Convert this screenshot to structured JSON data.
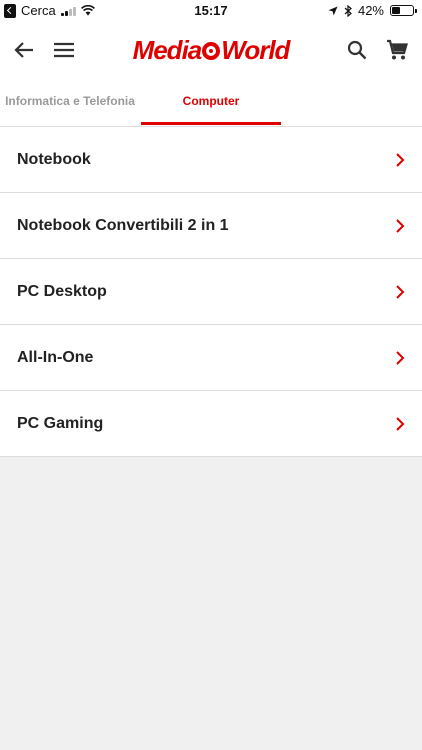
{
  "status_bar": {
    "back_app": "Cerca",
    "time": "15:17",
    "battery": "42%",
    "battery_level": 0.42,
    "icons": [
      "location-arrow-icon",
      "bluetooth-icon",
      "wifi-icon",
      "signal-icon",
      "battery-icon"
    ]
  },
  "header": {
    "logo_text_1": "Media",
    "logo_text_2": "World",
    "brand_color": "#df0000",
    "icons": [
      "back-arrow-icon",
      "hamburger-menu-icon",
      "search-icon",
      "cart-icon"
    ]
  },
  "tabs": [
    {
      "label": "Informatica e Telefonia",
      "active": false
    },
    {
      "label": "Computer",
      "active": true
    }
  ],
  "categories": [
    {
      "label": "Notebook"
    },
    {
      "label": "Notebook Convertibili 2 in 1"
    },
    {
      "label": "PC Desktop"
    },
    {
      "label": "All-In-One"
    },
    {
      "label": "PC Gaming"
    }
  ]
}
